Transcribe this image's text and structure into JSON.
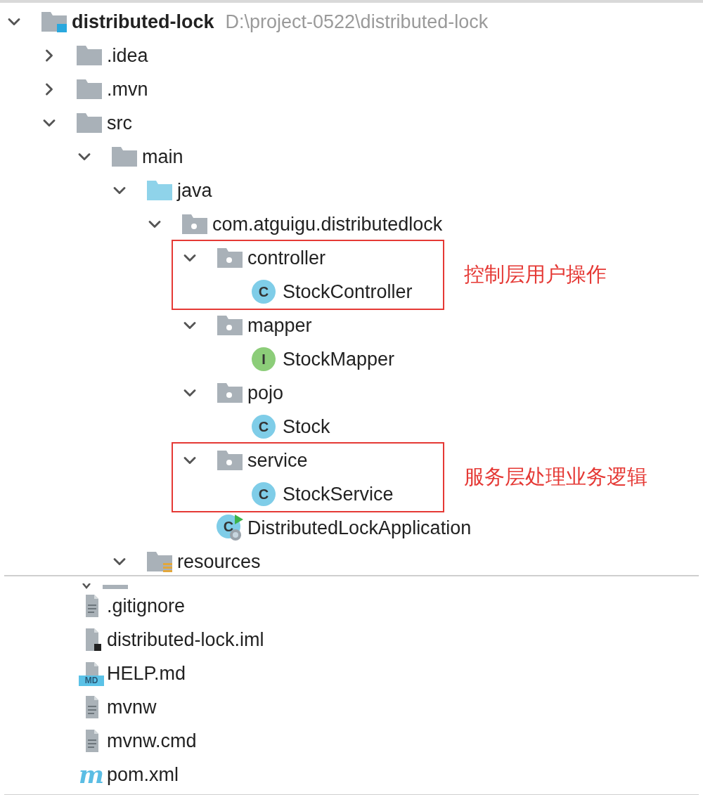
{
  "tree": {
    "label": "distributed-lock",
    "path": "D:\\project-0522\\distributed-lock",
    "kind": "module",
    "expanded": true,
    "children": [
      {
        "label": ".idea",
        "kind": "folder",
        "expanded": false
      },
      {
        "label": ".mvn",
        "kind": "folder",
        "expanded": false
      },
      {
        "label": "src",
        "kind": "folder",
        "expanded": true,
        "children": [
          {
            "label": "main",
            "kind": "folder",
            "expanded": true,
            "children": [
              {
                "label": "java",
                "kind": "source",
                "expanded": true,
                "children": [
                  {
                    "label": "com.atguigu.distributedlock",
                    "kind": "package",
                    "expanded": true,
                    "children": [
                      {
                        "label": "controller",
                        "kind": "package",
                        "expanded": true,
                        "annotation": "控制层用户操作",
                        "children": [
                          {
                            "label": "StockController",
                            "kind": "class",
                            "icon_text": "C"
                          }
                        ]
                      },
                      {
                        "label": "mapper",
                        "kind": "package",
                        "expanded": true,
                        "children": [
                          {
                            "label": "StockMapper",
                            "kind": "interface",
                            "icon_text": "I"
                          }
                        ]
                      },
                      {
                        "label": "pojo",
                        "kind": "package",
                        "expanded": true,
                        "children": [
                          {
                            "label": "Stock",
                            "kind": "class",
                            "icon_text": "C"
                          }
                        ]
                      },
                      {
                        "label": "service",
                        "kind": "package",
                        "expanded": true,
                        "annotation": "服务层处理业务逻辑",
                        "children": [
                          {
                            "label": "StockService",
                            "kind": "class",
                            "icon_text": "C"
                          }
                        ]
                      },
                      {
                        "label": "DistributedLockApplication",
                        "kind": "app",
                        "icon_text": "C"
                      }
                    ]
                  }
                ]
              },
              {
                "label": "resources",
                "kind": "resources",
                "expanded": true
              }
            ]
          }
        ]
      }
    ]
  },
  "files": [
    {
      "label": ".gitignore",
      "kind": "text"
    },
    {
      "label": "distributed-lock.iml",
      "kind": "iml"
    },
    {
      "label": "HELP.md",
      "kind": "md",
      "icon_text": "MD"
    },
    {
      "label": "mvnw",
      "kind": "text"
    },
    {
      "label": "mvnw.cmd",
      "kind": "text"
    },
    {
      "label": "pom.xml",
      "kind": "maven",
      "icon_text": "m"
    }
  ]
}
